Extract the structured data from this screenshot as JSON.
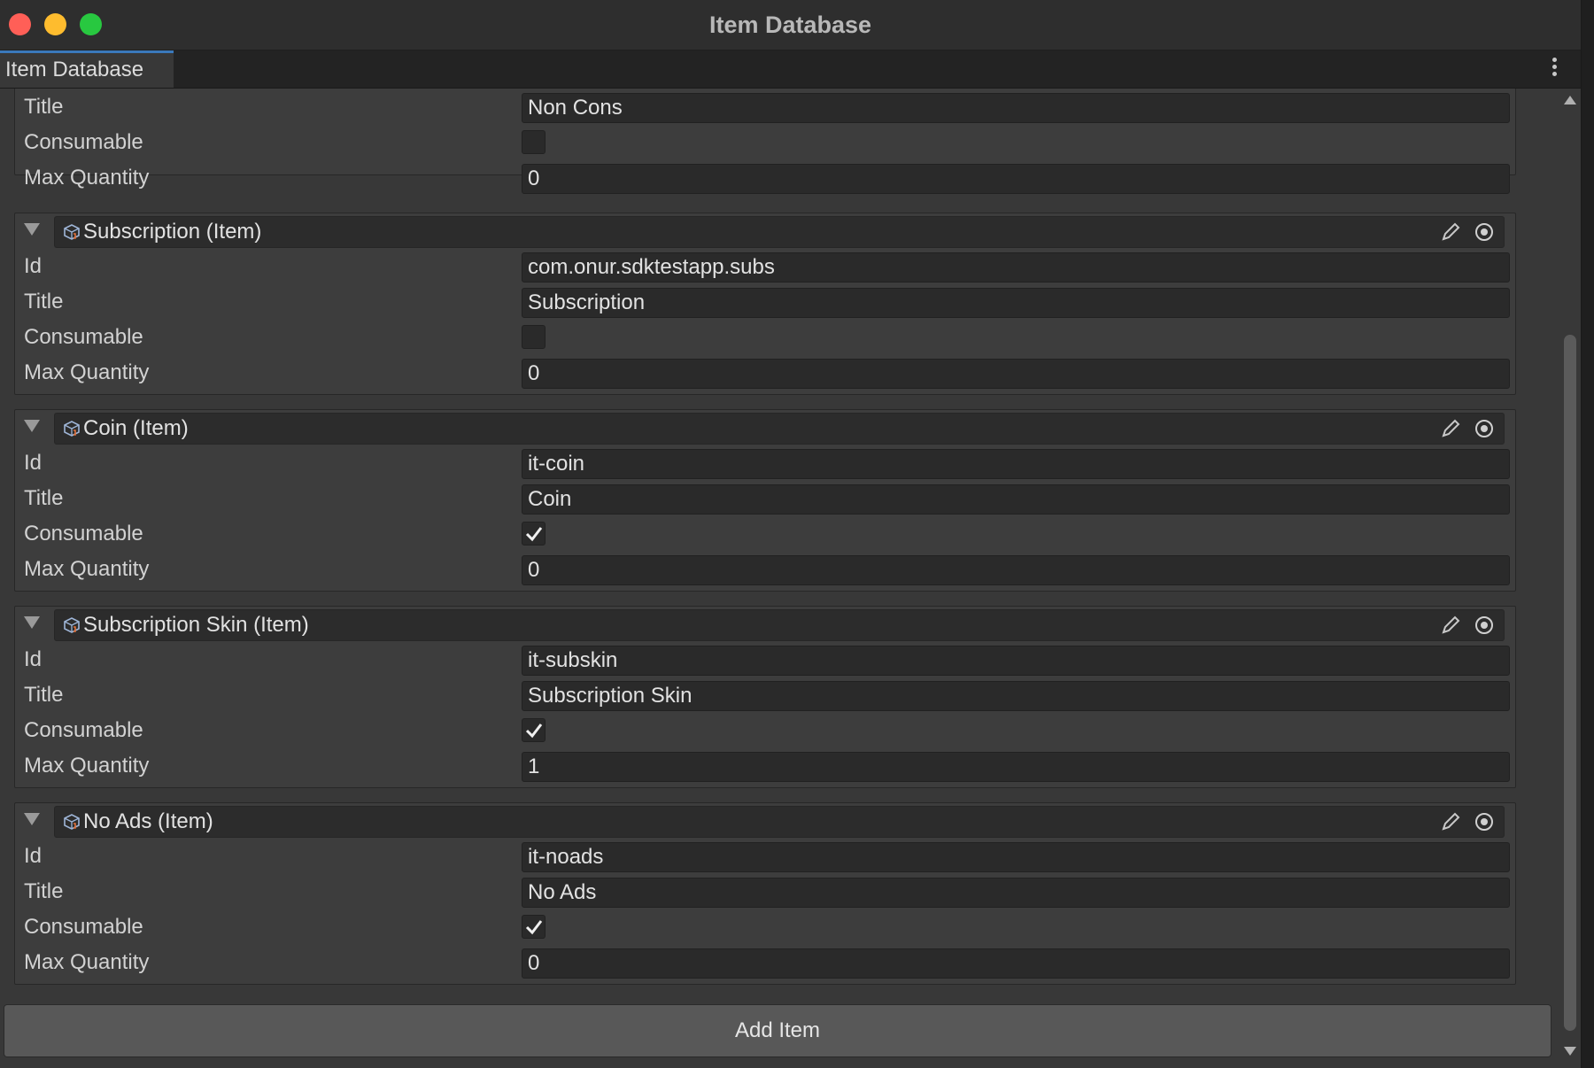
{
  "window": {
    "title": "Item Database"
  },
  "tab": {
    "label": "Item Database"
  },
  "labels": {
    "id": "Id",
    "title": "Title",
    "consumable": "Consumable",
    "max_quantity": "Max Quantity"
  },
  "partial_item": {
    "title": "Non Cons",
    "consumable": false,
    "max_quantity": "0"
  },
  "items": [
    {
      "header": "Subscription (Item)",
      "id": "com.onur.sdktestapp.subs",
      "title": "Subscription",
      "consumable": false,
      "max_quantity": "0"
    },
    {
      "header": "Coin (Item)",
      "id": "it-coin",
      "title": "Coin",
      "consumable": true,
      "max_quantity": "0"
    },
    {
      "header": "Subscription Skin (Item)",
      "id": "it-subskin",
      "title": "Subscription Skin",
      "consumable": true,
      "max_quantity": "1"
    },
    {
      "header": "No Ads (Item)",
      "id": "it-noads",
      "title": "No Ads",
      "consumable": true,
      "max_quantity": "0"
    }
  ],
  "actions": {
    "add_item": "Add Item"
  },
  "icons": {
    "remove": "close-icon",
    "edit": "pencil-icon",
    "select": "target-icon",
    "object": "scriptable-object-icon"
  }
}
